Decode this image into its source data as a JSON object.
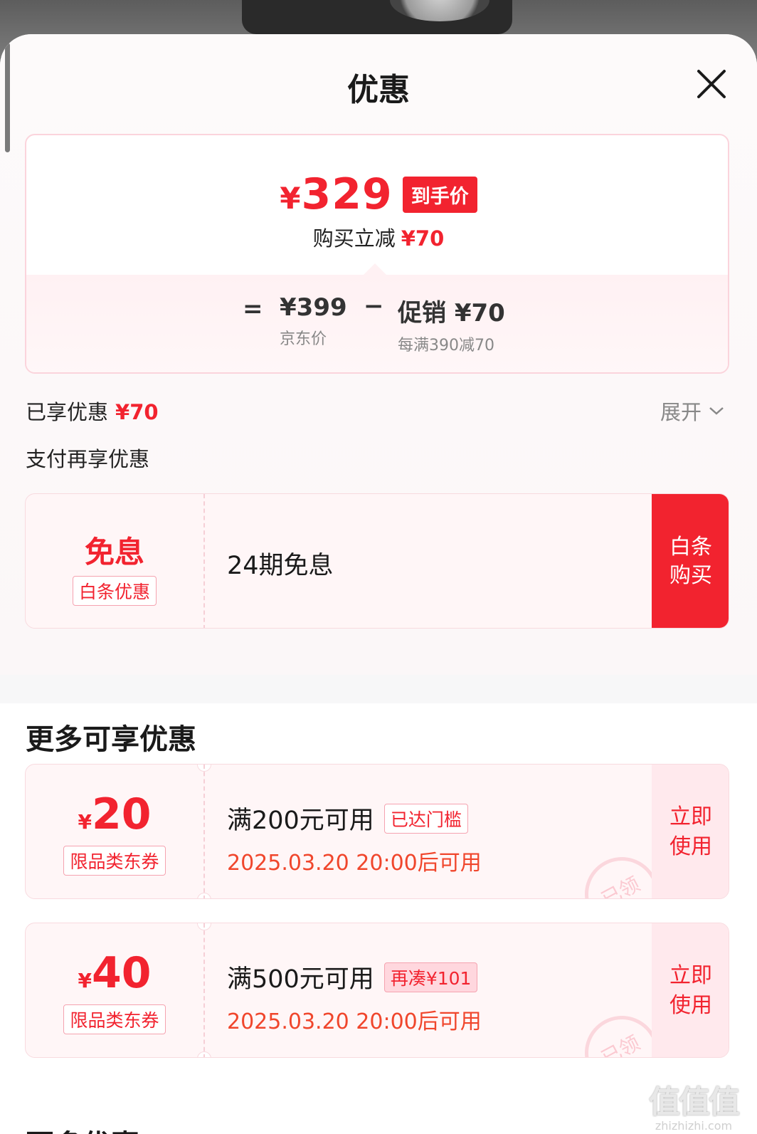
{
  "header": {
    "title": "优惠"
  },
  "price_card": {
    "final_price_symbol": "¥",
    "final_price": "329",
    "final_price_tag": "到手价",
    "reduce_label": "购买立减",
    "reduce_amount": "¥70",
    "equals": "=",
    "base_price": "¥399",
    "base_label": "京东价",
    "minus": "−",
    "promo_value": "促销 ¥70",
    "promo_label": "每满390减70"
  },
  "enjoyed": {
    "label": "已享优惠",
    "amount": "¥70",
    "expand_label": "展开"
  },
  "pay_section": {
    "title": "支付再享优惠",
    "card": {
      "big": "免息",
      "badge": "白条优惠",
      "desc": "24期免息",
      "cta_line1": "白条",
      "cta_line2": "购买"
    }
  },
  "more_section": {
    "title": "更多可享优惠",
    "coupons": [
      {
        "symbol": "¥",
        "amount": "20",
        "badge": "限品类东券",
        "condition": "满200元可用",
        "tag": "已达门槛",
        "time": "2025.03.20 20:00后可用",
        "use_line1": "立即",
        "use_line2": "使用",
        "stamp": "已领"
      },
      {
        "symbol": "¥",
        "amount": "40",
        "badge": "限品类东券",
        "condition": "满500元可用",
        "tag": "再凑¥101",
        "time": "2025.03.20 20:00后可用",
        "use_line1": "立即",
        "use_line2": "使用",
        "stamp": "已领"
      }
    ],
    "next_title": "更多优惠"
  },
  "watermark": {
    "glyphs": "值值值",
    "domain": "zhizhizhi.com"
  },
  "colors": {
    "accent": "#f2232f",
    "coupon_bg": "#fff6f7",
    "border": "#f8dadf"
  }
}
